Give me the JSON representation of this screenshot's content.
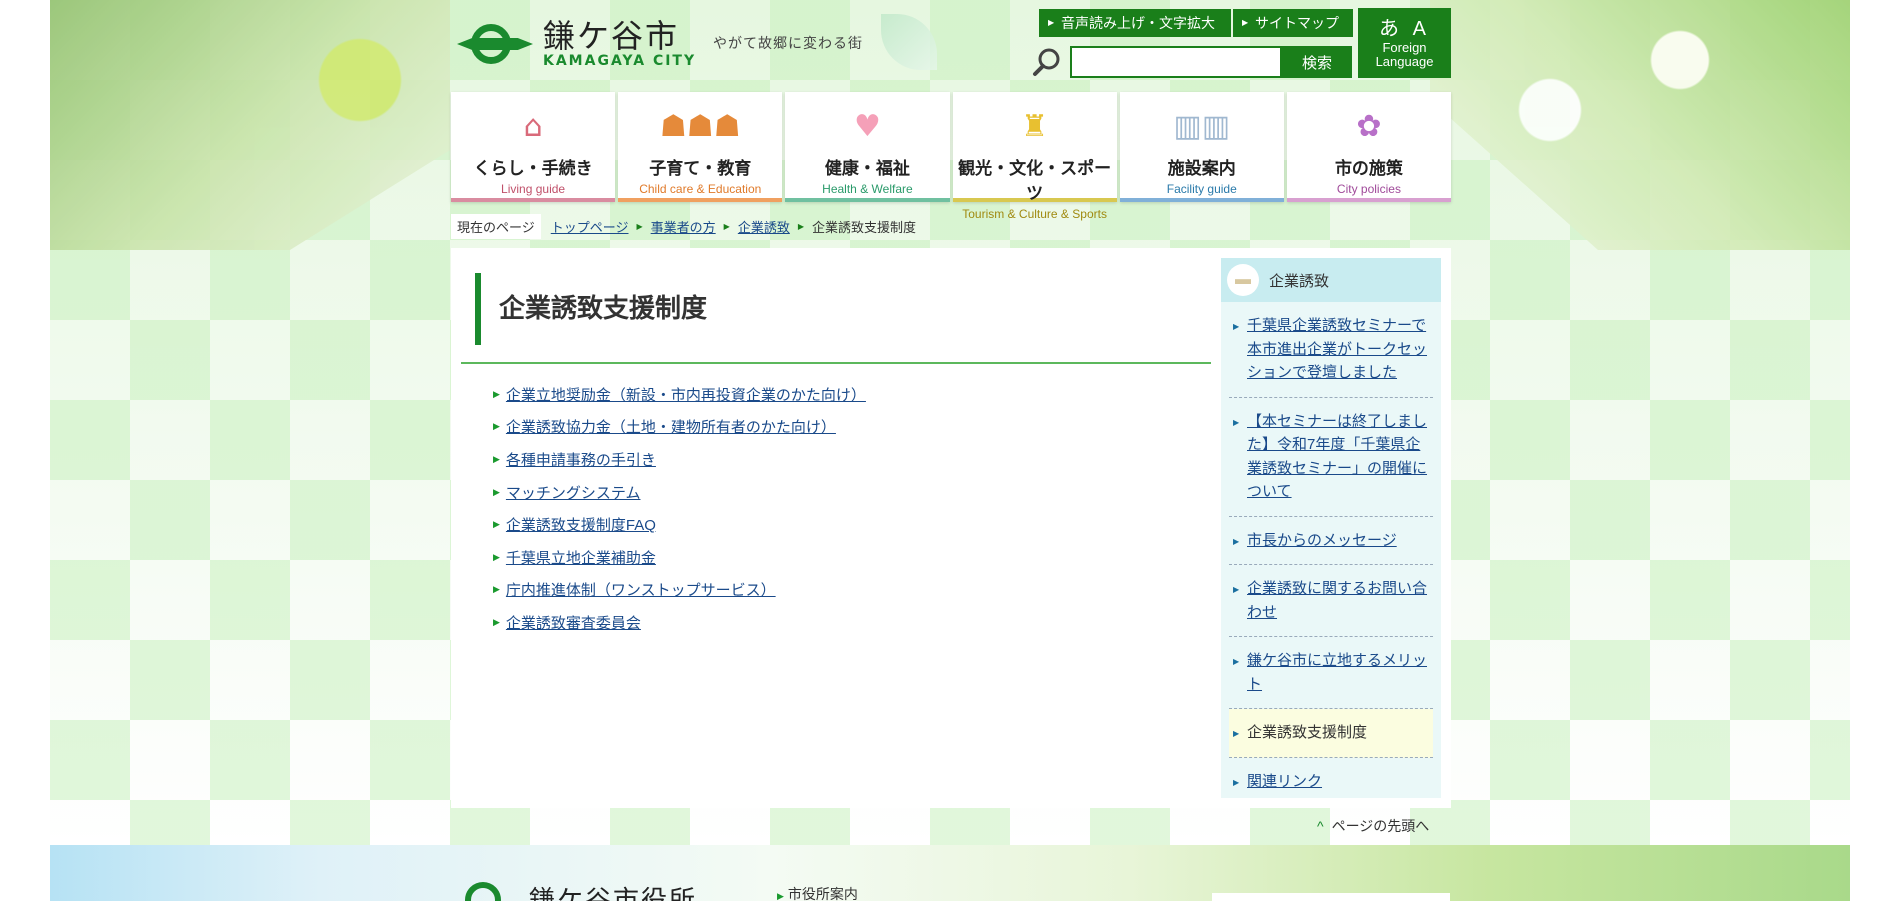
{
  "header": {
    "logo_ja": "鎌ケ谷市",
    "logo_en": "KAMAGAYA CITY",
    "tagline": "やがて故郷に変わる街",
    "voice_button": "音声読み上げ・文字拡大",
    "sitemap_button": "サイトマップ",
    "foreign_glyphs": "あ A",
    "foreign_label": "Foreign Language",
    "search_placeholder": "",
    "search_button": "検索"
  },
  "nav": [
    {
      "ja": "くらし・手続き",
      "en": "Living guide",
      "icon": "house-icon",
      "color": "#c0506a"
    },
    {
      "ja": "子育て・教育",
      "en": "Child care & Education",
      "icon": "family-icon",
      "color": "#e07a2a"
    },
    {
      "ja": "健康・福祉",
      "en": "Health & Welfare",
      "icon": "heart-icon",
      "color": "#2a9a6a"
    },
    {
      "ja": "観光・文化・スポーツ",
      "en": "Tourism & Culture & Sports",
      "icon": "statue-icon",
      "color": "#a08a10"
    },
    {
      "ja": "施設案内",
      "en": "Facility guide",
      "icon": "building-icon",
      "color": "#2a7aaa"
    },
    {
      "ja": "市の施策",
      "en": "City policies",
      "icon": "flower-icon",
      "color": "#a04a9a"
    }
  ],
  "breadcrumb": {
    "here_label": "現在のページ",
    "items": [
      "トップページ",
      "事業者の方",
      "企業誘致"
    ],
    "current": "企業誘致支援制度"
  },
  "main": {
    "title": "企業誘致支援制度",
    "links": [
      "企業立地奨励金（新設・市内再投資企業のかた向け）",
      "企業誘致協力金（土地・建物所有者のかた向け）",
      "各種申請事務の手引き",
      "マッチングシステム",
      "企業誘致支援制度FAQ",
      "千葉県立地企業補助金",
      "庁内推進体制（ワンストップサービス）",
      "企業誘致審査委員会"
    ]
  },
  "side": {
    "heading": "企業誘致",
    "items": [
      "千葉県企業誘致セミナーで本市進出企業がトークセッションで登壇しました",
      "【本セミナーは終了しました】令和7年度「千葉県企業誘致セミナー」の開催について",
      "市長からのメッセージ",
      "企業誘致に関するお問い合わせ",
      "鎌ケ谷市に立地するメリット",
      "企業誘致支援制度",
      "関連リンク"
    ],
    "current_index": 5
  },
  "pagetop": "ページの先頭へ",
  "footer": {
    "name": "鎌ケ谷市役所",
    "link": "市役所案内"
  }
}
